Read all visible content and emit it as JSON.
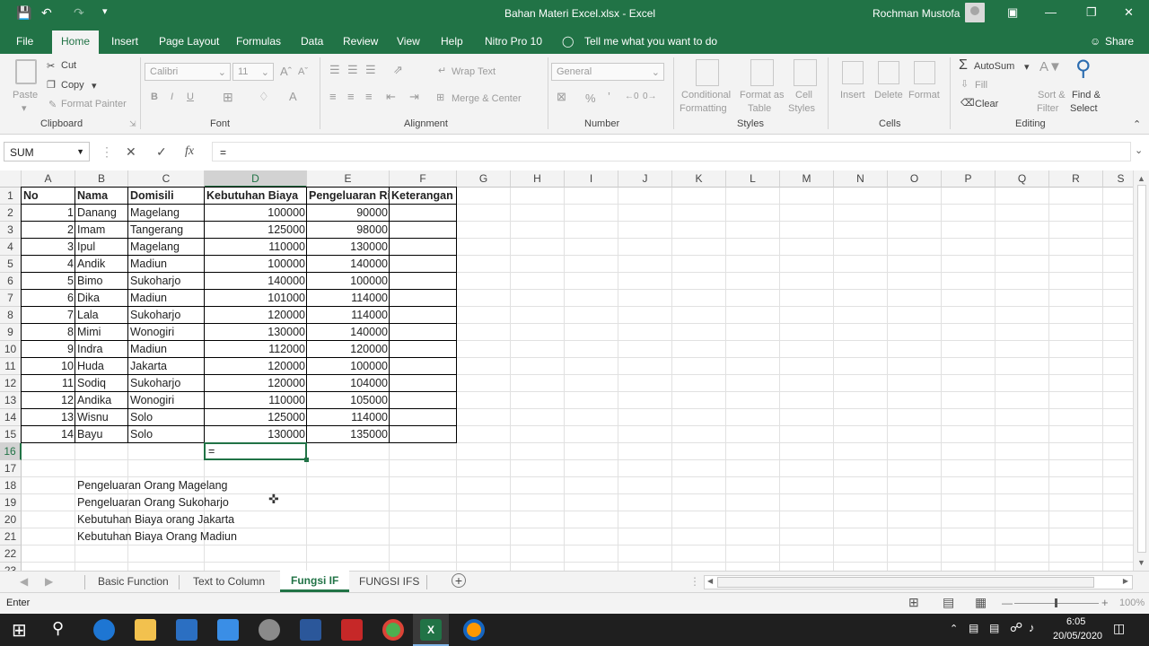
{
  "title_bar": {
    "document_title": "Bahan Materi Excel.xlsx  -  Excel",
    "user_name": "Rochman Mustofa"
  },
  "menu": {
    "items": [
      "File",
      "Home",
      "Insert",
      "Page Layout",
      "Formulas",
      "Data",
      "Review",
      "View",
      "Help",
      "Nitro Pro 10"
    ],
    "tell_me": "Tell me what you want to do",
    "share": "Share"
  },
  "ribbon": {
    "clipboard": {
      "paste": "Paste",
      "cut": "Cut",
      "copy": "Copy",
      "format_painter": "Format Painter",
      "group": "Clipboard"
    },
    "font": {
      "name": "Calibri",
      "size": "11",
      "group": "Font"
    },
    "alignment": {
      "wrap": "Wrap Text",
      "merge": "Merge & Center",
      "group": "Alignment"
    },
    "number": {
      "format": "General",
      "group": "Number"
    },
    "styles": {
      "conditional": "Conditional",
      "formatting": "Formatting",
      "format_as": "Format as",
      "table": "Table",
      "cell": "Cell",
      "cell_styles": "Styles",
      "group": "Styles"
    },
    "cells": {
      "insert": "Insert",
      "delete": "Delete",
      "format": "Format",
      "group": "Cells"
    },
    "editing": {
      "autosum": "AutoSum",
      "fill": "Fill",
      "clear": "Clear",
      "sort": "Sort &",
      "filter": "Filter",
      "find": "Find &",
      "select": "Select",
      "group": "Editing"
    }
  },
  "formula_bar": {
    "name_box": "SUM",
    "fx": "fx",
    "content": "="
  },
  "columns": [
    "A",
    "B",
    "C",
    "D",
    "E",
    "F",
    "G",
    "H",
    "I",
    "J",
    "K",
    "L",
    "M",
    "N",
    "O",
    "P",
    "Q",
    "R",
    "S"
  ],
  "rows": [
    "1",
    "2",
    "3",
    "4",
    "5",
    "6",
    "7",
    "8",
    "9",
    "10",
    "11",
    "12",
    "13",
    "14",
    "15",
    "16",
    "17",
    "18",
    "19",
    "20",
    "21",
    "22",
    "23"
  ],
  "table": {
    "headers": [
      "No",
      "Nama",
      "Domisili",
      "Kebutuhan Biaya",
      "Pengeluaran Ri",
      "Keterangan"
    ],
    "records": [
      [
        "1",
        "Danang",
        "Magelang",
        "100000",
        "90000"
      ],
      [
        "2",
        "Imam",
        "Tangerang",
        "125000",
        "98000"
      ],
      [
        "3",
        "Ipul",
        "Magelang",
        "110000",
        "130000"
      ],
      [
        "4",
        "Andik",
        "Madiun",
        "100000",
        "140000"
      ],
      [
        "5",
        "Bimo",
        "Sukoharjo",
        "140000",
        "100000"
      ],
      [
        "6",
        "Dika",
        "Madiun",
        "101000",
        "114000"
      ],
      [
        "7",
        "Lala",
        "Sukoharjo",
        "120000",
        "114000"
      ],
      [
        "8",
        "Mimi",
        "Wonogiri",
        "130000",
        "140000"
      ],
      [
        "9",
        "Indra",
        "Madiun",
        "112000",
        "120000"
      ],
      [
        "10",
        "Huda",
        "Jakarta",
        "120000",
        "100000"
      ],
      [
        "11",
        "Sodiq",
        "Sukoharjo",
        "120000",
        "104000"
      ],
      [
        "12",
        "Andika",
        "Wonogiri",
        "110000",
        "105000"
      ],
      [
        "13",
        "Wisnu",
        "Solo",
        "125000",
        "114000"
      ],
      [
        "14",
        "Bayu",
        "Solo",
        "130000",
        "135000"
      ]
    ]
  },
  "active_cell_value": "=",
  "notes": [
    "Pengeluaran Orang Magelang",
    "Pengeluaran Orang Sukoharjo",
    "Kebutuhan Biaya orang Jakarta",
    "Kebutuhan Biaya Orang Madiun"
  ],
  "sheet_tabs": [
    "Basic Function",
    "Text to Column",
    "Fungsi IF",
    "FUNGSI IFS"
  ],
  "status": {
    "mode": "Enter",
    "zoom": "100%"
  },
  "taskbar": {
    "time": "6:05",
    "date": "20/05/2020"
  },
  "colors": {
    "excel_green": "#217346",
    "taskbar": "#1f1f1f"
  }
}
